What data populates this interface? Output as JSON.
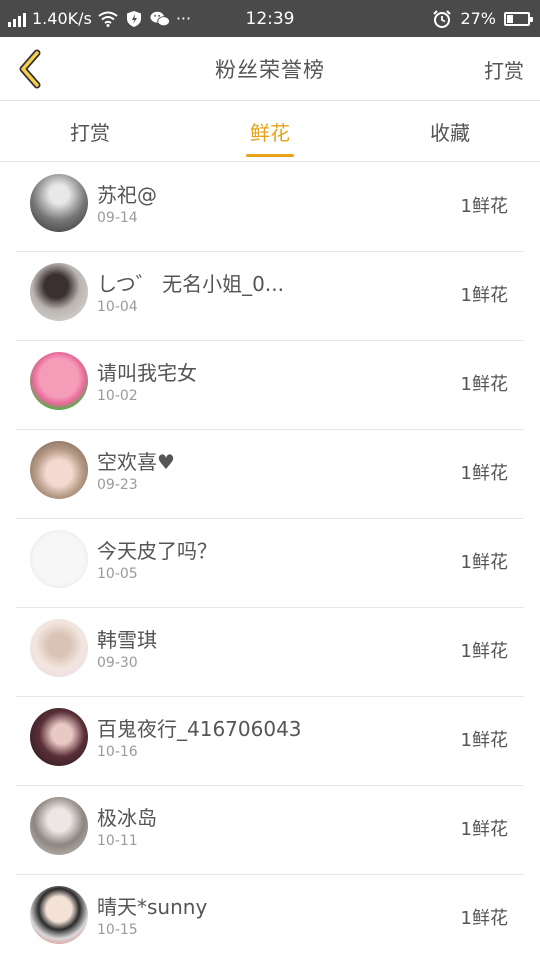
{
  "status_bar": {
    "speed": "1.40K/s",
    "time": "12:39",
    "battery": "27%",
    "battery_level": 0.27,
    "more": "···"
  },
  "header": {
    "title": "粉丝荣誉榜",
    "action": "打赏"
  },
  "tabs": [
    {
      "label": "打赏",
      "active": false
    },
    {
      "label": "鲜花",
      "active": true
    },
    {
      "label": "收藏",
      "active": false
    }
  ],
  "colors": {
    "accent": "#e8a21a",
    "status_bar": "#4a4a4a",
    "divider": "#e6e6e6"
  },
  "rows": [
    {
      "name": "苏祀@",
      "date": "09-14",
      "gift": "1鲜花"
    },
    {
      "name": "しつ゛ 无名小姐_0...",
      "date": "10-04",
      "gift": "1鲜花"
    },
    {
      "name": "请叫我宅女",
      "date": "10-02",
      "gift": "1鲜花"
    },
    {
      "name": "空欢喜♥",
      "date": "09-23",
      "gift": "1鲜花"
    },
    {
      "name": "今天皮了吗？",
      "date": "10-05",
      "gift": "1鲜花"
    },
    {
      "name": "韩雪琪",
      "date": "09-30",
      "gift": "1鲜花"
    },
    {
      "name": "百鬼夜行_416706043",
      "date": "10-16",
      "gift": "1鲜花"
    },
    {
      "name": "极冰岛",
      "date": "10-11",
      "gift": "1鲜花"
    },
    {
      "name": "晴天*sunny",
      "date": "10-15",
      "gift": "1鲜花"
    }
  ]
}
